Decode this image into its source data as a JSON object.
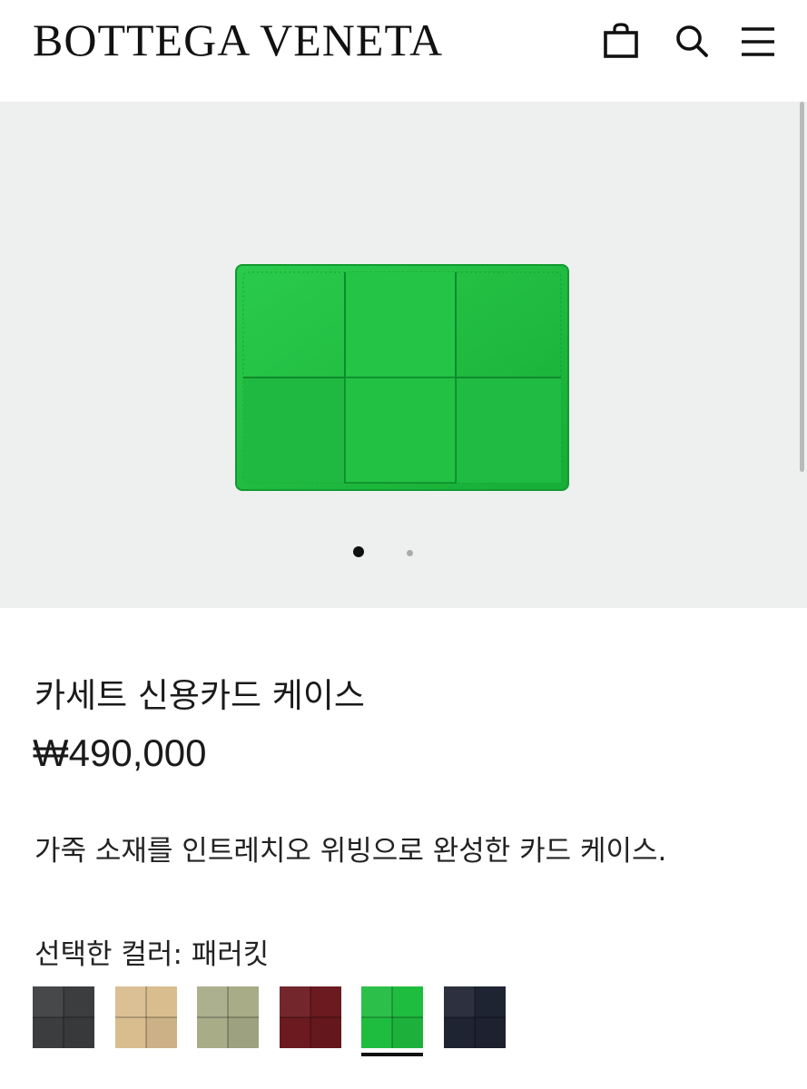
{
  "header": {
    "logo": "BOTTEGA VENETA",
    "icons": [
      "shopping-bag-icon",
      "search-icon",
      "menu-icon"
    ]
  },
  "gallery": {
    "image_count": 2,
    "active_index": 1
  },
  "product": {
    "title": "카세트 신용카드 케이스",
    "price": "₩490,000",
    "description": "가죽 소재를 인트레치오 위빙으로 완성한 카드 케이스.",
    "selected_color_label": "선택한 컬러: 패러킷",
    "product_color": "#1fbd3f"
  },
  "swatches": [
    {
      "color": "#3b3d3e",
      "selected": false
    },
    {
      "color": "#d9bd8f",
      "selected": false
    },
    {
      "color": "#a8ac87",
      "selected": false
    },
    {
      "color": "#6b1a1f",
      "selected": false
    },
    {
      "color": "#1fbd3f",
      "selected": true
    },
    {
      "color": "#1f2433",
      "selected": false
    }
  ]
}
